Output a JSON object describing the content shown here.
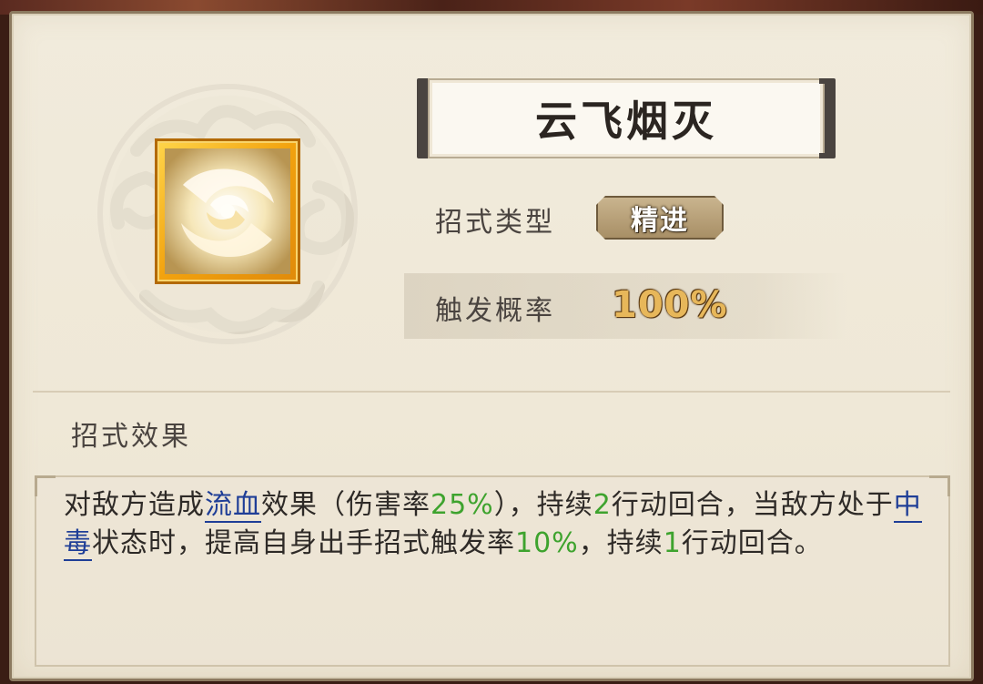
{
  "skill": {
    "name": "云飞烟灭",
    "type_label": "招式类型",
    "type_value": "精进",
    "rate_label": "触发概率",
    "rate_value": "100%"
  },
  "effect": {
    "section_title": "招式效果",
    "segments": {
      "s1": "对敌方造成",
      "s2": "流血",
      "s3": "效果（伤害率",
      "s4": "25%",
      "s5": "），持续",
      "s6": "2",
      "s7": "行动回合，当敌方处于",
      "s8": "中毒",
      "s9": "状态时，提高自身出手招式触发率",
      "s10": "10%",
      "s11": "，持续",
      "s12": "1",
      "s13": "行动回合。"
    }
  },
  "colors": {
    "link": "#1f3e97",
    "number": "#3ea32e",
    "rate_gold": "#e7b75a",
    "icon_frame": "#f2a20e"
  },
  "icons": {
    "skill_icon": "swirl-wind-icon",
    "background": "cloud-ornament"
  }
}
